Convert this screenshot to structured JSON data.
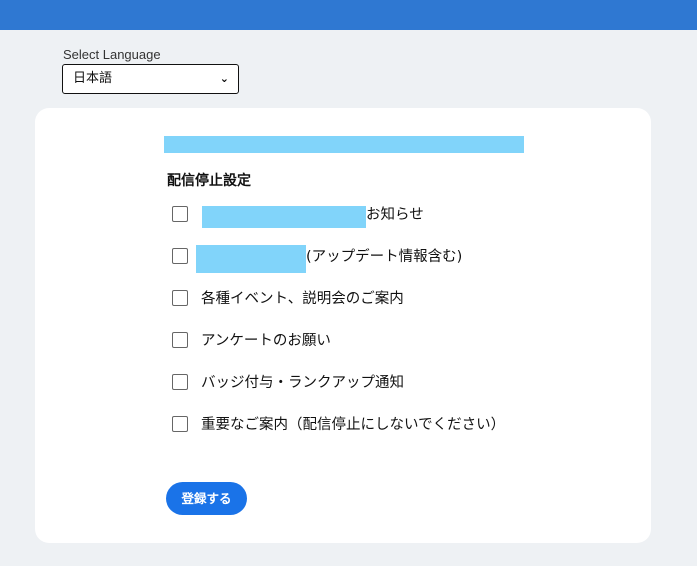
{
  "header": {
    "color": "#2f78d2"
  },
  "language": {
    "label": "Select Language",
    "selected": "日本語"
  },
  "card": {
    "section_title": "配信停止設定",
    "options": [
      {
        "label": "お知らせ",
        "checked": false
      },
      {
        "label": "(アップデート情報含む)",
        "checked": false
      },
      {
        "label": "各種イベント、説明会のご案内",
        "checked": false
      },
      {
        "label": "アンケートのお願い",
        "checked": false
      },
      {
        "label": "バッジ付与・ランクアップ通知",
        "checked": false
      },
      {
        "label": "重要なご案内（配信停止にしないでください）",
        "checked": false
      }
    ],
    "submit_label": "登録する"
  },
  "colors": {
    "redaction": "#81d4fa",
    "accent": "#1a73e8",
    "background": "#eef1f4"
  }
}
